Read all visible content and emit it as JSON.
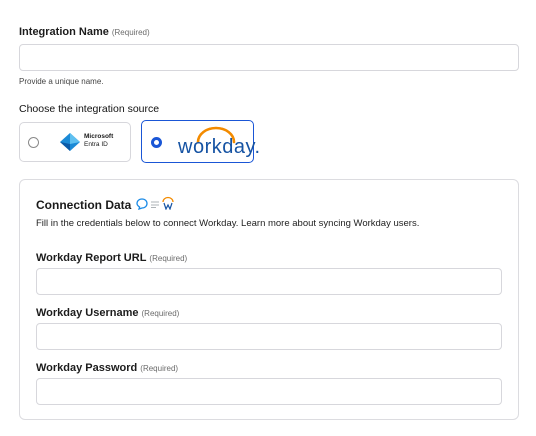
{
  "integration_name": {
    "label": "Integration Name",
    "required": "(Required)",
    "value": "",
    "hint": "Provide a unique name."
  },
  "source": {
    "heading": "Choose the integration source",
    "options": [
      {
        "name": "Microsoft",
        "sub": "Entra ID",
        "selected": false,
        "icon": "microsoft-entra-logo"
      },
      {
        "name": "workday.",
        "selected": true,
        "icon": "workday-logo"
      }
    ]
  },
  "connection": {
    "title": "Connection Data",
    "description": "Fill in the credentials below to connect Workday. Learn more about syncing Workday users.",
    "fields": [
      {
        "label": "Workday Report URL",
        "required": "(Required)",
        "value": ""
      },
      {
        "label": "Workday Username",
        "required": "(Required)",
        "value": ""
      },
      {
        "label": "Workday Password",
        "required": "(Required)",
        "value": ""
      }
    ]
  },
  "colors": {
    "accent": "#1a56d6",
    "workday_blue": "#1653a3",
    "workday_orange": "#f38b00",
    "border": "#d7d7dc"
  }
}
